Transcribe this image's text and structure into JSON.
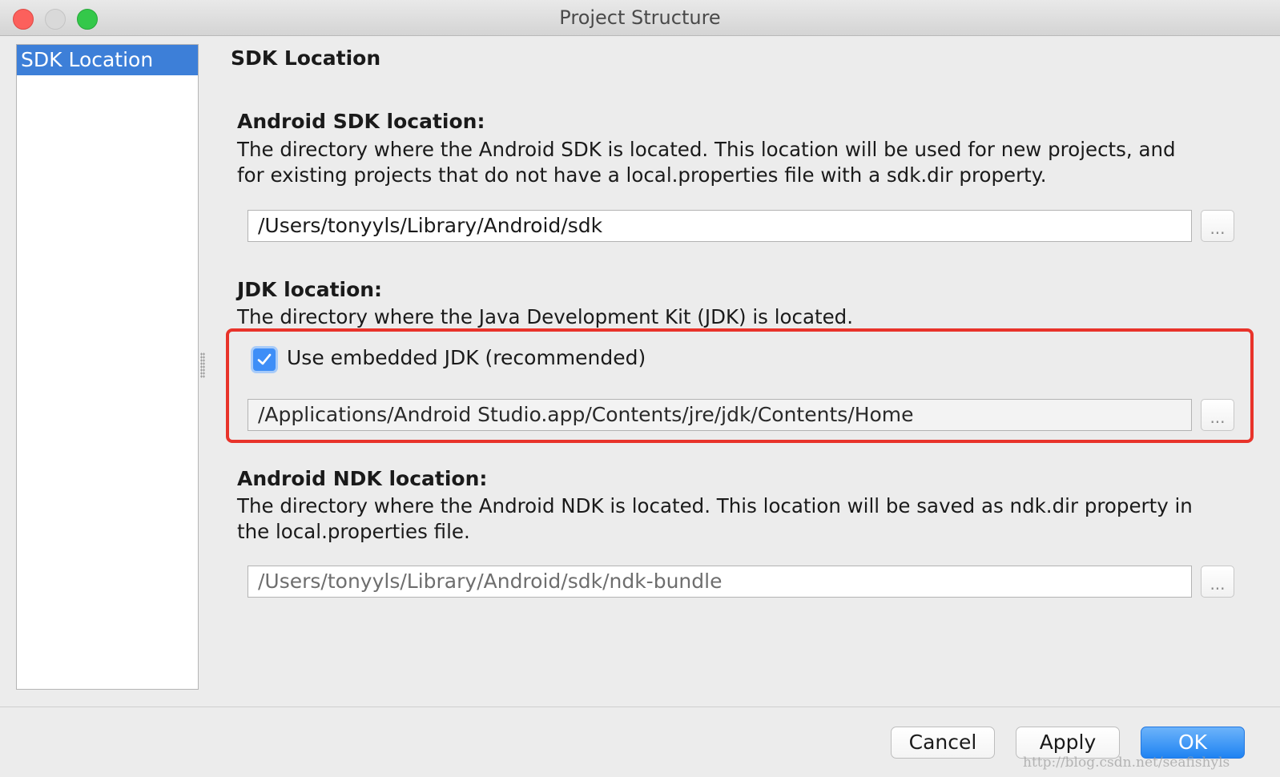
{
  "window": {
    "title": "Project Structure"
  },
  "sidebar": {
    "items": [
      {
        "label": "SDK Location",
        "selected": true
      }
    ]
  },
  "main": {
    "page_title": "SDK Location",
    "android_sdk": {
      "title": "Android SDK location:",
      "description_line1": "The directory where the Android SDK is located. This location will be used for new projects, and",
      "description_line2": "for existing projects that do not have a local.properties file with a sdk.dir property.",
      "path": "/Users/tonyyls/Library/Android/sdk",
      "browse_label": "..."
    },
    "jdk": {
      "title": "JDK location:",
      "description": "The directory where the Java Development Kit (JDK) is located.",
      "embedded_checkbox_label": "Use embedded JDK (recommended)",
      "embedded_checked": true,
      "path": "/Applications/Android Studio.app/Contents/jre/jdk/Contents/Home",
      "browse_label": "..."
    },
    "android_ndk": {
      "title": "Android NDK location:",
      "description_line1": "The directory where the Android NDK is located. This location will be saved as ndk.dir property in",
      "description_line2": "the local.properties file.",
      "placeholder": "/Users/tonyyls/Library/Android/sdk/ndk-bundle",
      "browse_label": "..."
    }
  },
  "footer": {
    "cancel_label": "Cancel",
    "apply_label": "Apply",
    "ok_label": "OK"
  },
  "watermark": "http://blog.csdn.net/seafishyls",
  "colors": {
    "selection": "#3d7fd8",
    "highlight_border": "#e8332a",
    "checkbox": "#3e8ef7",
    "ok_button": "#1f83f2"
  },
  "icons": {
    "close": "close-icon",
    "minimize": "minimize-icon",
    "maximize": "maximize-icon",
    "checkmark": "checkmark-icon"
  }
}
